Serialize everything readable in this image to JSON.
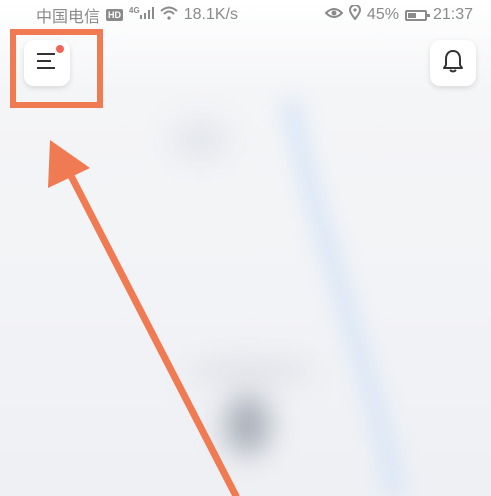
{
  "status_bar": {
    "carrier": "中国电信",
    "hd_badge": "HD",
    "network_type": "4G",
    "speed": "18.1K/s",
    "battery_percent": "45%",
    "battery_level": 0.45,
    "time": "21:37"
  },
  "header": {
    "menu_icon": "hamburger-menu-icon",
    "bell_icon": "bell-icon",
    "notification_dot_color": "#f0645a"
  },
  "annotation": {
    "color": "#f07a52"
  }
}
